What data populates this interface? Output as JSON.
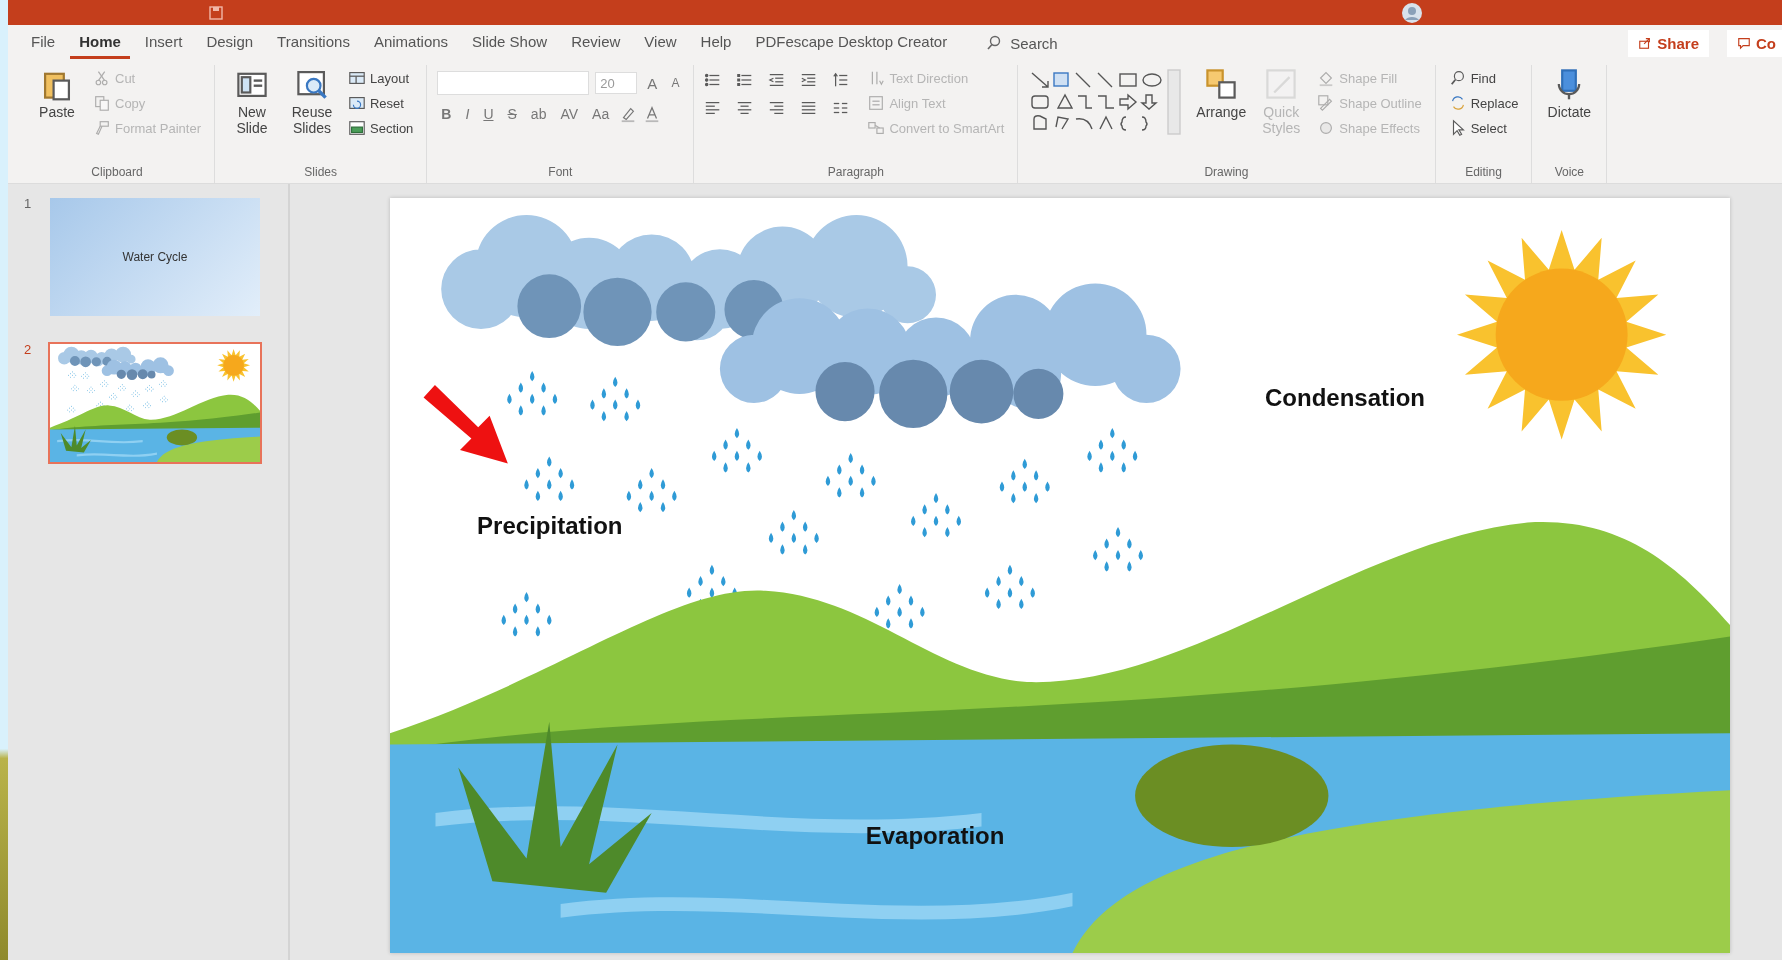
{
  "tabs": [
    {
      "label": "File",
      "selected": false
    },
    {
      "label": "Home",
      "selected": true
    },
    {
      "label": "Insert",
      "selected": false
    },
    {
      "label": "Design",
      "selected": false
    },
    {
      "label": "Transitions",
      "selected": false
    },
    {
      "label": "Animations",
      "selected": false
    },
    {
      "label": "Slide Show",
      "selected": false
    },
    {
      "label": "Review",
      "selected": false
    },
    {
      "label": "View",
      "selected": false
    },
    {
      "label": "Help",
      "selected": false
    },
    {
      "label": "PDFescape Desktop Creator",
      "selected": false
    }
  ],
  "search": {
    "placeholder": "Search"
  },
  "share_button": "Share",
  "comments_button": "Co",
  "ribbon_groups": [
    {
      "label": "Clipboard",
      "kind": "buttons",
      "items": [
        {
          "label": "Paste",
          "kind": "large",
          "disabled": false
        },
        {
          "label": "Cut",
          "kind": "small",
          "disabled": true
        },
        {
          "label": "Copy",
          "kind": "small",
          "disabled": true
        },
        {
          "label": "Format Painter",
          "kind": "small",
          "disabled": true
        }
      ]
    },
    {
      "label": "Slides",
      "kind": "buttons",
      "items": [
        {
          "label": "New\nSlide",
          "kind": "large",
          "disabled": false
        },
        {
          "label": "Reuse\nSlides",
          "kind": "large",
          "disabled": false
        },
        {
          "label": "Layout",
          "kind": "small",
          "disabled": false
        },
        {
          "label": "Reset",
          "kind": "small",
          "disabled": false
        },
        {
          "label": "Section",
          "kind": "small",
          "disabled": false
        }
      ]
    },
    {
      "label": "Font",
      "kind": "font",
      "font_size": "20",
      "size_buttons": [
        "A",
        "A"
      ],
      "format_buttons": [
        "B",
        "I",
        "U",
        "S",
        "ab",
        "AV",
        "Aa"
      ]
    },
    {
      "label": "Paragraph",
      "kind": "paragraph",
      "items": [
        {
          "label": "Text Direction",
          "kind": "small",
          "disabled": true
        },
        {
          "label": "Align Text",
          "kind": "small",
          "disabled": true
        },
        {
          "label": "Convert to SmartArt",
          "kind": "small",
          "disabled": true
        }
      ]
    },
    {
      "label": "Drawing",
      "kind": "drawing",
      "items": [
        {
          "label": "Arrange",
          "kind": "large",
          "disabled": false
        },
        {
          "label": "Quick\nStyles",
          "kind": "large",
          "disabled": true
        },
        {
          "label": "Shape Fill",
          "kind": "small",
          "disabled": true
        },
        {
          "label": "Shape Outline",
          "kind": "small",
          "disabled": true
        },
        {
          "label": "Shape Effects",
          "kind": "small",
          "disabled": true
        }
      ]
    },
    {
      "label": "Editing",
      "kind": "buttons",
      "items": [
        {
          "label": "Find",
          "kind": "small",
          "disabled": false
        },
        {
          "label": "Replace",
          "kind": "small",
          "disabled": false
        },
        {
          "label": "Select",
          "kind": "small",
          "disabled": false
        }
      ]
    },
    {
      "label": "Voice",
      "kind": "buttons",
      "items": [
        {
          "label": "Dictate",
          "kind": "large",
          "disabled": false
        }
      ]
    }
  ],
  "slides": [
    {
      "number": "1",
      "kind": "title",
      "title": "Water Cycle",
      "selected": false
    },
    {
      "number": "2",
      "kind": "picture",
      "selected": true
    }
  ],
  "slide": {
    "condensation_label": "Condensation",
    "precipitation_label": "Precipitation",
    "evaporation_label": "Evaporation"
  }
}
